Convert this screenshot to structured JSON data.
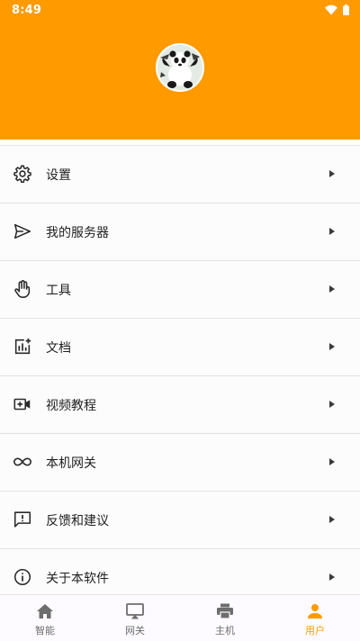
{
  "status_bar": {
    "time": "8:49",
    "icons": [
      "wifi-icon",
      "battery-icon"
    ]
  },
  "profile": {
    "avatar": "panda-avatar"
  },
  "colors": {
    "accent": "#ff9a00",
    "icon": "#2b2b2b",
    "nav_inactive": "#6d6d6d"
  },
  "menu": [
    {
      "label": "设置",
      "icon": "gear-icon"
    },
    {
      "label": "我的服务器",
      "icon": "send-icon"
    },
    {
      "label": "工具",
      "icon": "hand-icon"
    },
    {
      "label": "文档",
      "icon": "chart-add-icon"
    },
    {
      "label": "视频教程",
      "icon": "video-add-icon"
    },
    {
      "label": "本机网关",
      "icon": "infinity-icon"
    },
    {
      "label": "反馈和建议",
      "icon": "feedback-icon"
    },
    {
      "label": "关于本软件",
      "icon": "info-icon"
    }
  ],
  "bottom_nav": [
    {
      "label": "智能",
      "icon": "home-icon",
      "active": false
    },
    {
      "label": "网关",
      "icon": "cast-icon",
      "active": false
    },
    {
      "label": "主机",
      "icon": "printer-icon",
      "active": false
    },
    {
      "label": "用户",
      "icon": "person-icon",
      "active": true
    }
  ]
}
